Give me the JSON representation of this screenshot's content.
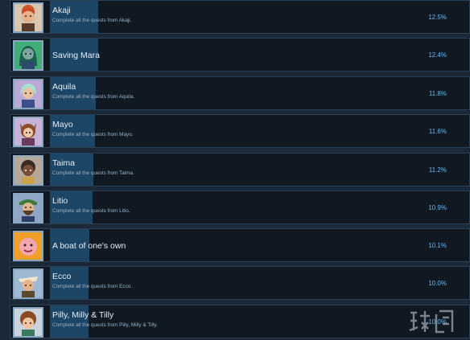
{
  "achievements": [
    {
      "name": "Akaji",
      "description": "Complete all the quests from Akaji.",
      "percent": "12.5%",
      "icon": "character-portrait-icon",
      "fill": 0.125
    },
    {
      "name": "Saving Mara",
      "description": "",
      "percent": "12.4%",
      "icon": "character-portrait-icon",
      "fill": 0.124
    },
    {
      "name": "Aquila",
      "description": "Complete all the quests from Aquila.",
      "percent": "11.8%",
      "icon": "character-portrait-icon",
      "fill": 0.118
    },
    {
      "name": "Mayo",
      "description": "Complete all the quests from Mayo.",
      "percent": "11.6%",
      "icon": "character-portrait-icon",
      "fill": 0.116
    },
    {
      "name": "Taima",
      "description": "Complete all the quests from Taima.",
      "percent": "11.2%",
      "icon": "character-portrait-icon",
      "fill": 0.112
    },
    {
      "name": "Litio",
      "description": "Complete all the quests from Litio.",
      "percent": "10.9%",
      "icon": "character-portrait-icon",
      "fill": 0.109
    },
    {
      "name": "A boat of one's own",
      "description": "",
      "percent": "10.1%",
      "icon": "character-portrait-icon",
      "fill": 0.101
    },
    {
      "name": "Ecco",
      "description": "Complete all the quests from Ecco.",
      "percent": "10.0%",
      "icon": "character-portrait-icon",
      "fill": 0.1
    },
    {
      "name": "Pilly, Milly & Tilly",
      "description": "Complete all the quests from Pilly, Milly & Tilly.",
      "percent": "10.0%",
      "icon": "character-portrait-icon",
      "fill": 0.1
    }
  ],
  "watermark": {
    "text": "游侠网"
  },
  "colors": {
    "background": "#1b2838",
    "row_background": "#101822",
    "row_border": "#2b4055",
    "progress_bar": "#1e4a6e",
    "percent_text": "#66b9f0"
  }
}
